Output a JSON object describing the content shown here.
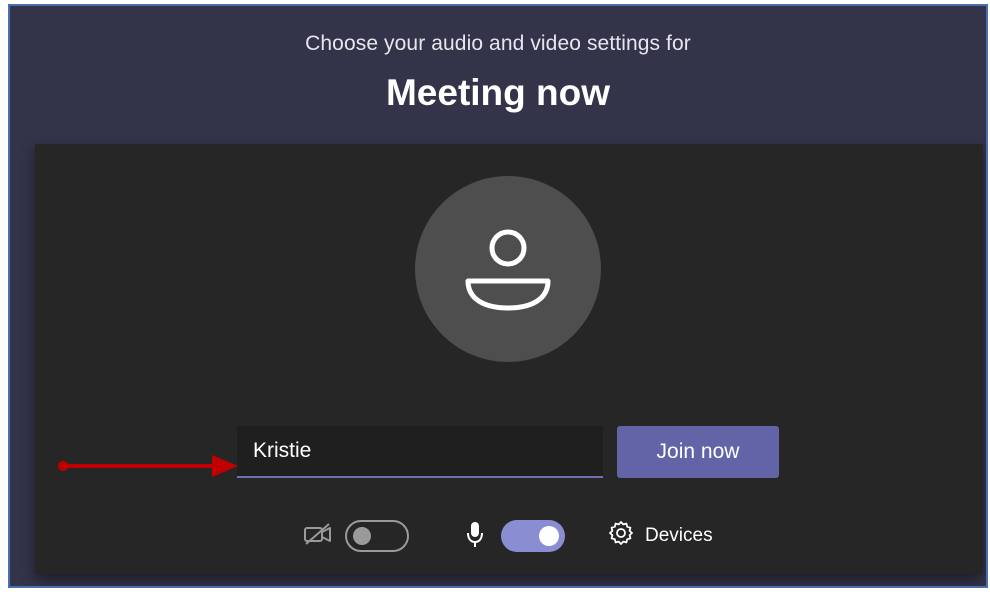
{
  "header": {
    "subtitle": "Choose your audio and video settings for",
    "title": "Meeting now"
  },
  "preview": {
    "avatar_icon": "person-icon"
  },
  "join": {
    "name_value": "Kristie",
    "join_label": "Join now"
  },
  "controls": {
    "camera_icon": "camera-off-icon",
    "camera_on": false,
    "mic_icon": "microphone-icon",
    "mic_on": true,
    "devices_icon": "gear-icon",
    "devices_label": "Devices"
  },
  "annotation": {
    "arrow_color": "#c00000"
  },
  "colors": {
    "background": "#33344a",
    "accent": "#6264a7",
    "toggle_on": "#8b8dd3"
  }
}
